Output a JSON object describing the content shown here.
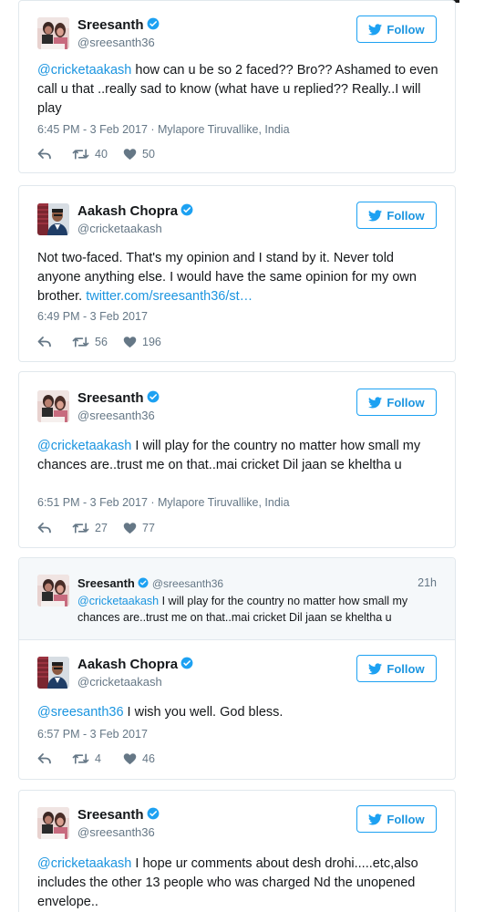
{
  "follow_label": "Follow",
  "colors": {
    "accent": "#1da1f2",
    "text": "#14171a",
    "muted": "#657786",
    "border": "#e1e8ed"
  },
  "icons": {
    "bird": "twitter-bird-icon",
    "verified": "verified-badge-icon",
    "reply": "reply-icon",
    "retweet": "retweet-icon",
    "like": "heart-icon"
  },
  "tweets": [
    {
      "name": "Sreesanth",
      "handle": "@sreesanth36",
      "mention": "@cricketaakash",
      "body": " how can u be so 2 faced?? Bro?? Ashamed to even call u that ..really sad to know (what have u replied?? Really..I will play",
      "meta": "6:45 PM - 3 Feb 2017 · Mylapore Tiruvallike, India",
      "retweets": "40",
      "likes": "50"
    },
    {
      "name": "Aakash Chopra",
      "handle": "@cricketaakash",
      "body": "Not two-faced. That's my opinion and I stand by it. Never told anyone anything else. I would have the same opinion for my own brother. ",
      "link": "twitter.com/sreesanth36/st…",
      "meta": "6:49 PM - 3 Feb 2017",
      "retweets": "56",
      "likes": "196"
    },
    {
      "name": "Sreesanth",
      "handle": "@sreesanth36",
      "mention": "@cricketaakash",
      "body": " I will play for the country no matter how small my chances are..trust me on that..mai cricket Dil jaan se kheltha u",
      "meta": "6:51 PM - 3 Feb 2017 · Mylapore Tiruvallike, India",
      "retweets": "27",
      "likes": "77"
    },
    {
      "quoted": {
        "name": "Sreesanth",
        "handle": "@sreesanth36",
        "time": "21h",
        "mention": "@cricketaakash",
        "body": " I will play for the country no matter how small my chances are..trust me on that..mai cricket Dil jaan se kheltha u"
      },
      "name": "Aakash Chopra",
      "handle": "@cricketaakash",
      "mention": "@sreesanth36",
      "body": " I wish you well. God bless.",
      "meta": "6:57 PM - 3 Feb 2017",
      "retweets": "4",
      "likes": "46"
    },
    {
      "name": "Sreesanth",
      "handle": "@sreesanth36",
      "mention": "@cricketaakash",
      "body": " I hope ur comments about desh drohi.....etc,also includes the other 13 people who was charged Nd the unopened envelope.."
    }
  ]
}
